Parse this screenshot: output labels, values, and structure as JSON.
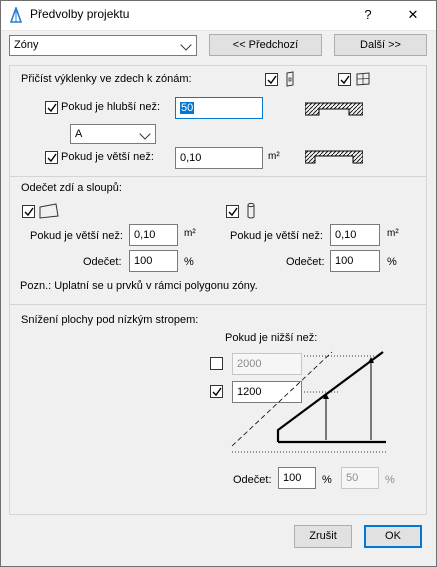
{
  "window": {
    "title": "Předvolby projektu",
    "help_label": "?",
    "close_label": "✕"
  },
  "nav": {
    "category_value": "Zóny",
    "prev_label": "<< Předchozí",
    "next_label": "Další >>"
  },
  "niches": {
    "header": "Přičíst výklenky ve zdech k zónám:",
    "wall_opening_checked": true,
    "window_opening_checked": true,
    "deeper_label": "Pokud je hlubší než:",
    "deeper_checked": true,
    "deeper_value": "50",
    "reference_value": "A",
    "larger_label": "Pokud je větší než:",
    "larger_checked": true,
    "larger_value": "0,10",
    "larger_unit": "m²"
  },
  "walls_columns": {
    "header": "Odečet zdí a sloupů:",
    "wall": {
      "checked": true,
      "larger_label": "Pokud je větší než:",
      "larger_value": "0,10",
      "larger_unit": "m²",
      "deduct_label": "Odečet:",
      "deduct_value": "100",
      "deduct_unit": "%"
    },
    "column": {
      "checked": true,
      "larger_label": "Pokud je větší než:",
      "larger_value": "0,10",
      "larger_unit": "m²",
      "deduct_label": "Odečet:",
      "deduct_value": "100",
      "deduct_unit": "%"
    },
    "note": "Pozn.:  Uplatní se u prvků v rámci polygonu zóny."
  },
  "low_ceiling": {
    "header": "Snížení plochy pod nízkým stropem:",
    "lower_label": "Pokud je nižší než:",
    "height1_checked": false,
    "height1_value": "2000",
    "height2_checked": true,
    "height2_value": "1200",
    "deduct_label": "Odečet:",
    "deduct1_value": "100",
    "deduct1_unit": "%",
    "deduct2_value": "50",
    "deduct2_unit": "%"
  },
  "footer": {
    "cancel_label": "Zrušit",
    "ok_label": "OK"
  },
  "colors": {
    "accent": "#0078d7",
    "dialog_bg": "#f0f0f0",
    "button_bg": "#e1e1e1"
  }
}
